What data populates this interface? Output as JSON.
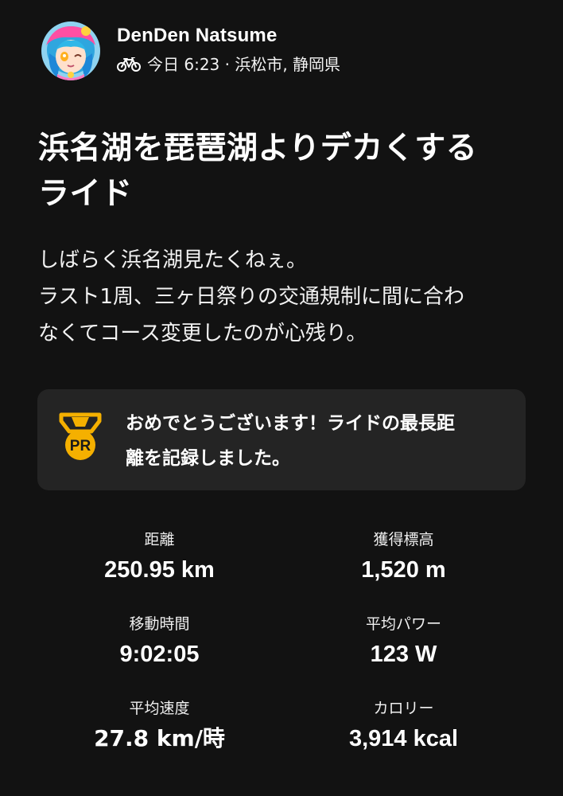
{
  "post": {
    "athlete_name": "DenDen Natsume",
    "activity_icon": "bike-icon",
    "meta_text": "今日 6:23 · 浜松市, 静岡県",
    "title_lines": [
      "浜名湖を琵琶湖よりデカくする",
      "ライド"
    ],
    "description_lines": [
      "しばらく浜名湖見たくねぇ。",
      "ラスト1周、三ヶ日祭りの交通規制に間に合わ",
      "なくてコース変更したのが心残り。"
    ]
  },
  "achievement": {
    "icon": "pr-medal-icon",
    "icon_label": "PR",
    "text_lines": [
      "おめでとうございます！ライドの最長距",
      "離を記録しました。"
    ],
    "accent_color": "#f5b000"
  },
  "stats": [
    {
      "label": "距離",
      "value": "250.95 km"
    },
    {
      "label": "獲得標高",
      "value": "1,520 m"
    },
    {
      "label": "移動時間",
      "value": "9:02:05"
    },
    {
      "label": "平均パワー",
      "value": "123 W"
    },
    {
      "label": "平均速度",
      "value": "27.8 km/時"
    },
    {
      "label": "カロリー",
      "value": "3,914 kcal"
    }
  ]
}
